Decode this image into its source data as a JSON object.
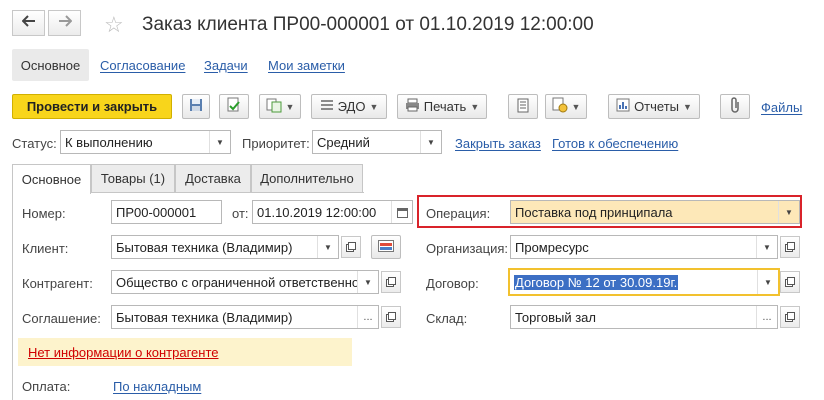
{
  "window": {
    "title": "Заказ клиента ПР00-000001 от 01.10.2019 12:00:00",
    "back_icon": "arrow-left-icon",
    "forward_icon": "arrow-right-icon",
    "favorite_icon": "star-icon"
  },
  "view_tabs": [
    "Основное",
    "Согласование",
    "Задачи",
    "Мои заметки"
  ],
  "toolbar": {
    "post_close": "Провести и закрыть",
    "edo": "ЭДО",
    "print": "Печать",
    "reports": "Отчеты",
    "files": "Файлы"
  },
  "status_row": {
    "status_label": "Статус:",
    "status_value": "К выполнению",
    "priority_label": "Приоритет:",
    "priority_value": "Средний",
    "close_order": "Закрыть заказ",
    "ready_supply": "Готов к обеспечению"
  },
  "tabs": [
    "Основное",
    "Товары (1)",
    "Доставка",
    "Дополнительно"
  ],
  "form": {
    "number_label": "Номер:",
    "number_value": "ПР00-000001",
    "date_label": "от:",
    "date_value": "01.10.2019 12:00:00",
    "client_label": "Клиент:",
    "client_value": "Бытовая техника (Владимир)",
    "contractor_label": "Контрагент:",
    "contractor_value": "Общество с ограниченной ответственно",
    "agreement_label": "Соглашение:",
    "agreement_value": "Бытовая техника (Владимир)",
    "operation_label": "Операция:",
    "operation_value": "Поставка под принципала",
    "org_label": "Организация:",
    "org_value": "Промресурс",
    "contract_label": "Договор:",
    "contract_value": "Договор № 12 от 30.09.19г.",
    "warehouse_label": "Склад:",
    "warehouse_value": "Торговый зал",
    "warning": "Нет информации о контрагенте",
    "payment_label": "Оплата:",
    "payment_value": "По накладным"
  },
  "colors": {
    "primary_button": "#f8d51b",
    "operation_highlight": "#fde8b8",
    "operation_border": "#d9232a",
    "contract_border": "#f2c12e",
    "link": "#2a5da8",
    "warning_text": "#d00000"
  }
}
